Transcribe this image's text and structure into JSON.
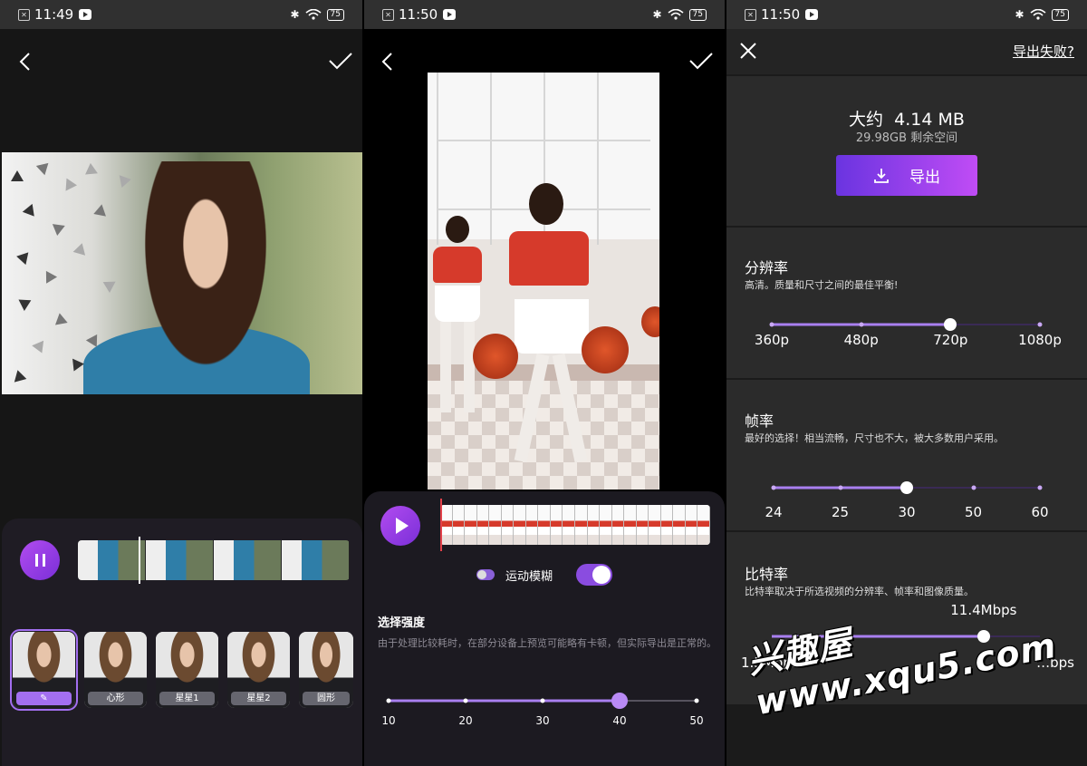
{
  "status_bars": [
    {
      "time": "11:49",
      "battery": "75"
    },
    {
      "time": "11:50",
      "battery": "75"
    },
    {
      "time": "11:50",
      "battery": "75"
    }
  ],
  "screen1": {
    "effects": [
      {
        "label": ""
      },
      {
        "label": "心形"
      },
      {
        "label": "星星1"
      },
      {
        "label": "星星2"
      },
      {
        "label": "圆形"
      }
    ]
  },
  "screen2": {
    "motion_blur_label": "运动模糊",
    "motion_blur_enabled": true,
    "strength_title": "选择强度",
    "strength_note": "由于处理比较耗时，在部分设备上预览可能略有卡顿，但实际导出是正常的。",
    "strength_ticks": [
      "10",
      "20",
      "30",
      "40",
      "50"
    ],
    "strength_value": 40
  },
  "screen3": {
    "export_failed": "导出失败?",
    "size_label": "大约",
    "size_value": "4.14 MB",
    "free_space": "29.98GB 剩余空间",
    "export_label": "导出",
    "resolution": {
      "title": "分辨率",
      "desc": "高清。质量和尺寸之间的最佳平衡!",
      "ticks": [
        "360p",
        "480p",
        "720p",
        "1080p"
      ],
      "selected_index": 2
    },
    "framerate": {
      "title": "帧率",
      "desc": "最好的选择！相当流畅，尺寸也不大，被大多数用户采用。",
      "ticks": [
        "24",
        "25",
        "30",
        "50",
        "60"
      ],
      "selected_index": 2
    },
    "bitrate": {
      "title": "比特率",
      "desc": "比特率取决于所选视频的分辨率、帧率和图像质量。",
      "current": "11.4Mbps",
      "min": "1.5Mbps",
      "max": "…bps",
      "position_fraction": 0.79
    }
  },
  "watermark": "兴趣屋 www.xqu5.com",
  "colors": {
    "accent": "#a36ff0",
    "accent_gradient_start": "#6a34e0",
    "accent_gradient_end": "#c04cf5"
  }
}
